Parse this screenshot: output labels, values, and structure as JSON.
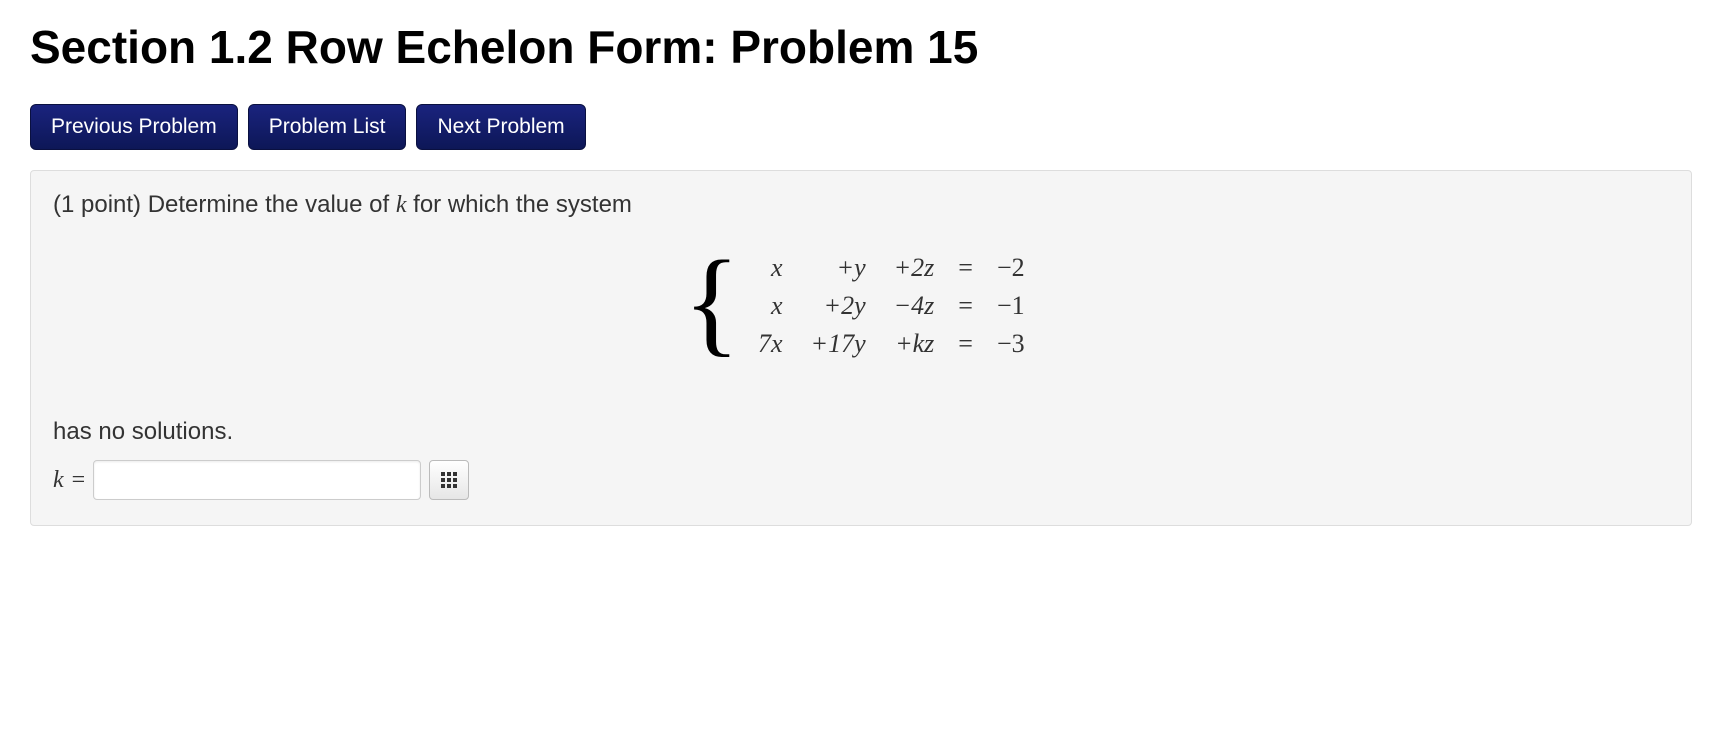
{
  "title": "Section 1.2 Row Echelon Form: Problem 15",
  "nav": {
    "prev": "Previous Problem",
    "list": "Problem List",
    "next": "Next Problem"
  },
  "problem": {
    "prompt_prefix": "(1 point) Determine the value of ",
    "prompt_var": "k",
    "prompt_suffix": " for which the system",
    "equations": [
      {
        "c1": "x",
        "c2": "+y",
        "c3": "+2z",
        "eq": "=",
        "rhs": "−2"
      },
      {
        "c1": "x",
        "c2": "+2y",
        "c3": "−4z",
        "eq": "=",
        "rhs": "−1"
      },
      {
        "c1": "7x",
        "c2": "+17y",
        "c3": "+kz",
        "eq": "=",
        "rhs": "−3"
      }
    ],
    "post_text": "has no solutions.",
    "answer_var": "k",
    "answer_eq": "=",
    "answer_value": ""
  }
}
